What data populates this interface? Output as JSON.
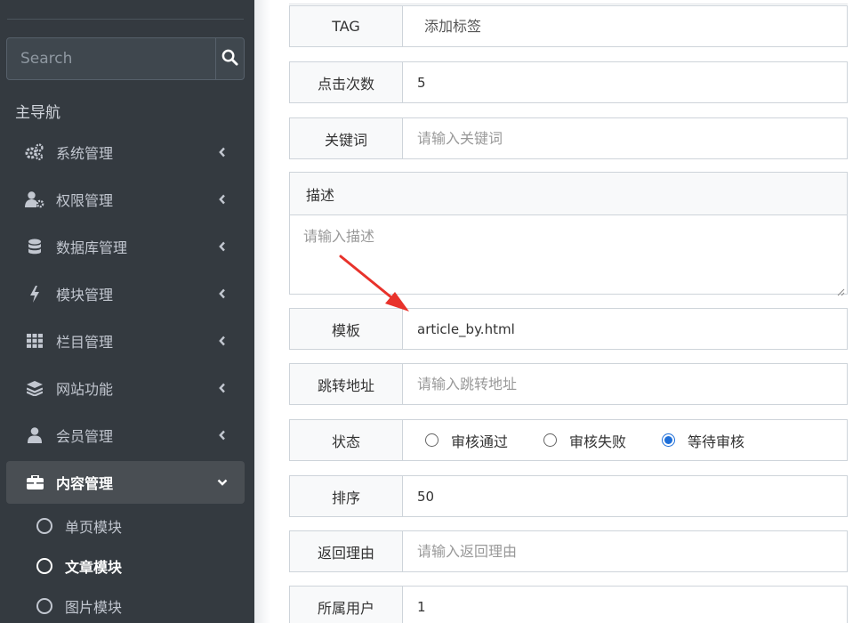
{
  "sidebar": {
    "search": {
      "placeholder": "Search"
    },
    "nav_header": "主导航",
    "items": [
      {
        "label": "系统管理",
        "icon": "cogs-icon"
      },
      {
        "label": "权限管理",
        "icon": "user-cog-icon"
      },
      {
        "label": "数据库管理",
        "icon": "database-icon"
      },
      {
        "label": "模块管理",
        "icon": "bolt-icon"
      },
      {
        "label": "栏目管理",
        "icon": "grid-icon"
      },
      {
        "label": "网站功能",
        "icon": "layers-icon"
      },
      {
        "label": "会员管理",
        "icon": "user-icon"
      },
      {
        "label": "内容管理",
        "icon": "briefcase-icon",
        "active": true
      }
    ],
    "sub_items": [
      {
        "label": "单页模块"
      },
      {
        "label": "文章模块",
        "current": true
      },
      {
        "label": "图片模块"
      }
    ]
  },
  "form": {
    "tag": {
      "label": "TAG",
      "placeholder": "添加标签"
    },
    "clicks": {
      "label": "点击次数",
      "value": "5"
    },
    "keywords": {
      "label": "关键词",
      "placeholder": "请输入关键词"
    },
    "description": {
      "label": "描述",
      "placeholder": "请输入描述"
    },
    "template": {
      "label": "模板",
      "value": "article_by.html"
    },
    "redirect": {
      "label": "跳转地址",
      "placeholder": "请输入跳转地址"
    },
    "status": {
      "label": "状态",
      "options": [
        {
          "label": "审核通过",
          "checked": false
        },
        {
          "label": "审核失败",
          "checked": false
        },
        {
          "label": "等待审核",
          "checked": true
        }
      ]
    },
    "sort": {
      "label": "排序",
      "value": "50"
    },
    "reason": {
      "label": "返回理由",
      "placeholder": "请输入返回理由"
    },
    "owner": {
      "label": "所属用户",
      "value": "1"
    }
  },
  "colors": {
    "sidebar_bg": "#343a40",
    "accent_radio": "#1e6fd9",
    "annotation_arrow": "#e8322b"
  }
}
